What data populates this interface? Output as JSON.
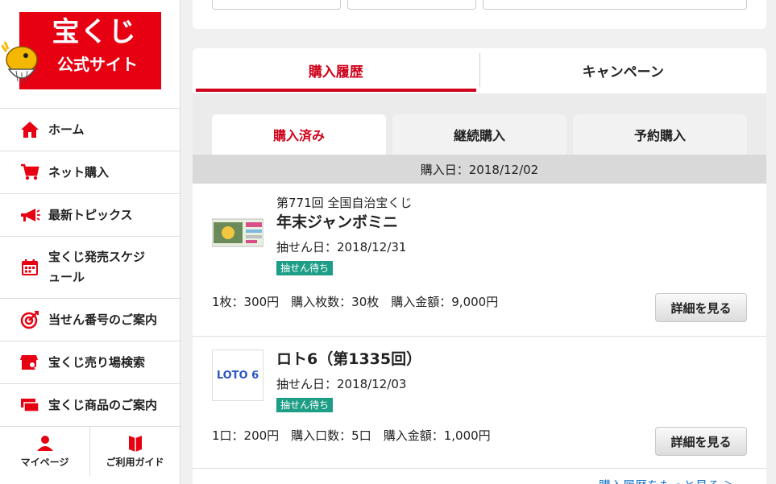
{
  "logo": {
    "line1": "宝くじ",
    "line2": "公式サイト"
  },
  "nav": {
    "items": [
      {
        "label": "ホーム",
        "icon": "home-icon"
      },
      {
        "label": "ネット購入",
        "icon": "cart-icon"
      },
      {
        "label": "最新トピックス",
        "icon": "megaphone-icon"
      },
      {
        "label": "宝くじ発売スケジュール",
        "icon": "calendar-icon"
      },
      {
        "label": "当せん番号のご案内",
        "icon": "target-icon"
      },
      {
        "label": "宝くじ売り場検索",
        "icon": "store-search-icon"
      },
      {
        "label": "宝くじ商品のご案内",
        "icon": "tickets-icon"
      }
    ],
    "mypage": "マイページ",
    "guide": "ご利用ガイド"
  },
  "tabs": {
    "history": "購入履歴",
    "campaign": "キャンペーン"
  },
  "subtabs": {
    "purchased": "購入済み",
    "continuous": "継続購入",
    "reserved": "予約購入"
  },
  "purchase_date": "購入日：2018/12/02",
  "purchases": [
    {
      "round": "第771回 全国自治宝くじ",
      "name": "年末ジャンボミニ",
      "draw_date": "抽せん日：2018/12/31",
      "status": "抽せん待ち",
      "summary": "1枚：300円　購入枚数：30枚　購入金額：9,000円",
      "detail_label": "詳細を見る"
    },
    {
      "round": "",
      "name": "ロト6（第1335回）",
      "draw_date": "抽せん日：2018/12/03",
      "status": "抽せん待ち",
      "summary": "1口：200円　購入口数：5口　購入金額：1,000円",
      "detail_label": "詳細を見る",
      "logo_text": "LOTO 6"
    }
  ],
  "more_link": "購入履歴をもっと見る ＞",
  "colors": {
    "brand_red": "#e60012",
    "status_green": "#1e9e86",
    "link_blue": "#1a73c8"
  }
}
